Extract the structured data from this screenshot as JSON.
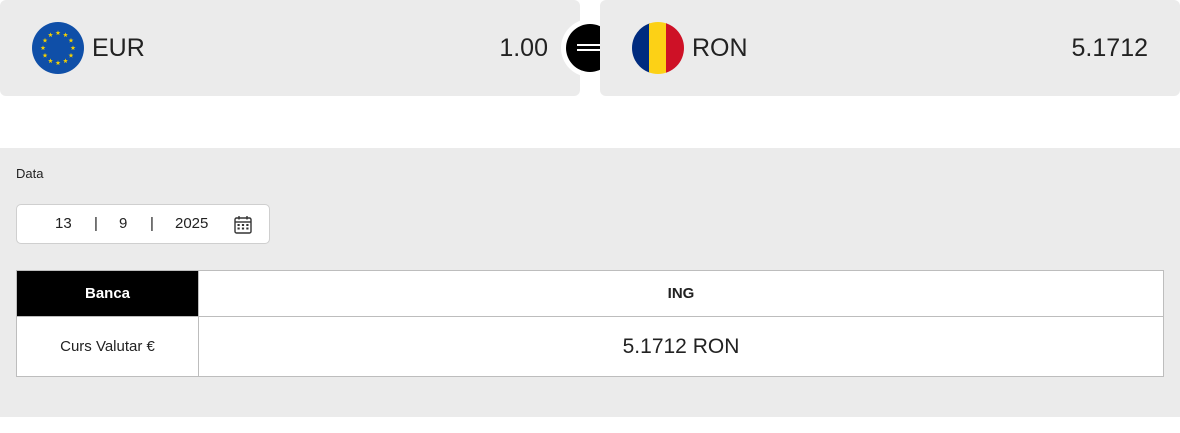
{
  "converter": {
    "from": {
      "code": "EUR",
      "amount": "1.00",
      "flag": "eu-flag-icon"
    },
    "to": {
      "code": "RON",
      "amount": "5.1712",
      "flag": "romania-flag-icon"
    },
    "swap_icon": "equals-icon"
  },
  "date": {
    "label": "Data",
    "day": "13",
    "separator": "|",
    "month": "9",
    "year": "2025",
    "icon": "calendar-icon"
  },
  "table": {
    "header_label": "Banca",
    "header_bank": "ING",
    "row_label": "Curs Valutar €",
    "row_value": "5.1712 RON"
  },
  "colors": {
    "card_bg": "#ebebeb",
    "eu_blue": "#0f4fa8",
    "eu_star": "#f5d100",
    "ro_blue": "#002b7f",
    "ro_yellow": "#fcd116",
    "ro_red": "#ce1126",
    "header_black": "#000000"
  }
}
